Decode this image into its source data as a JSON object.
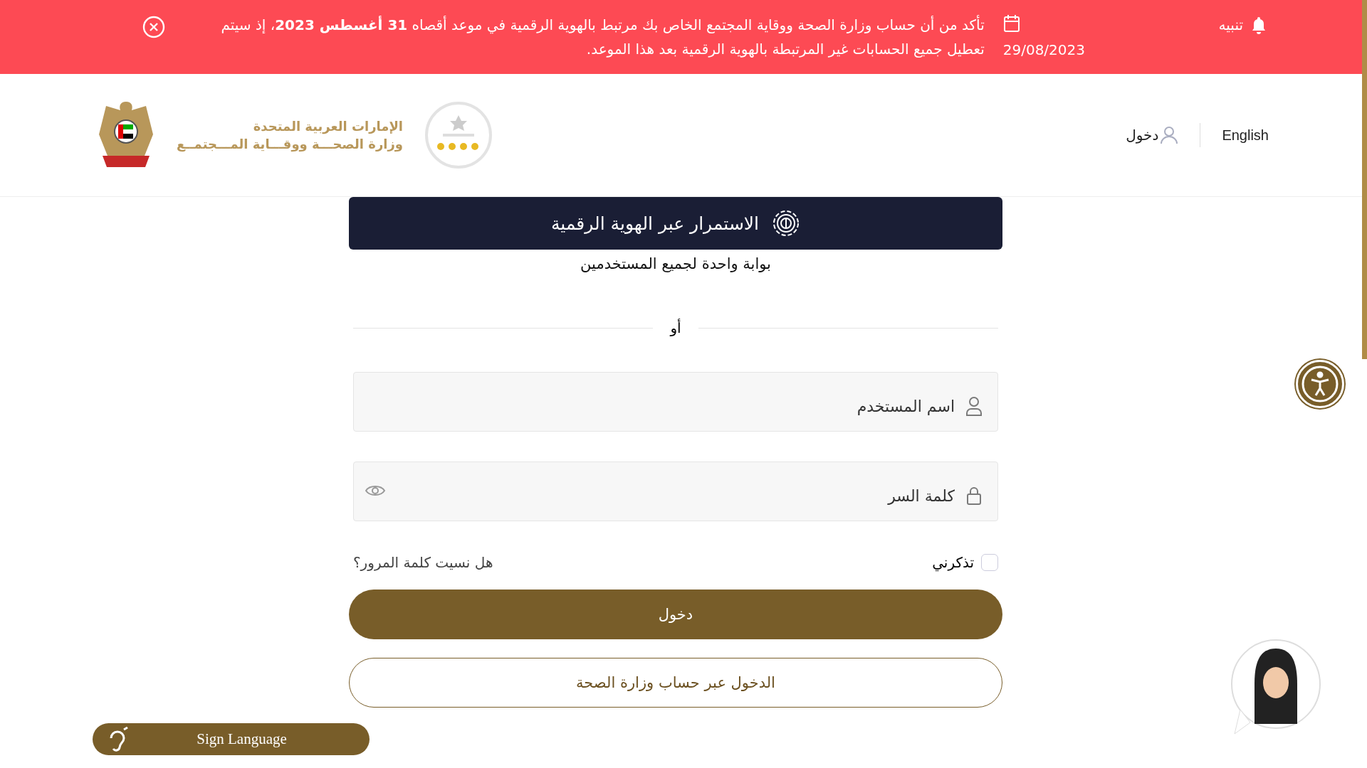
{
  "alert": {
    "label": "تنبيه",
    "date": "29/08/2023",
    "message": "تأكد من أن حساب وزارة الصحة ووقاية المجتمع الخاص بك مرتبط بالهوية الرقمية في موعد أقصاه **31 أغسطس 2023**، إذ سيتم تعطيل جميع الحسابات غير المرتبطة بالهوية الرقمية بعد هذا الموعد."
  },
  "header": {
    "language": "English",
    "login": "دخول",
    "logo_lines": [
      "الإمارات العربية المتحدة",
      "وزارة الصحـــة ووقـــاية المـــجتمــع"
    ]
  },
  "digital_id": {
    "button": "الاستمرار عبر الهوية الرقمية",
    "subtitle": "بوابة واحدة لجميع المستخدمين"
  },
  "divider": "أو",
  "fields": [
    {
      "kind": "text",
      "placeholder": "اسم المستخدم"
    },
    {
      "kind": "password",
      "placeholder": "كلمة السر"
    }
  ],
  "remember": {
    "label": "تذكرني",
    "checked": false
  },
  "forgot_link": "هل نسيت كلمة المرور؟",
  "buttons": [
    {
      "kind": "primary",
      "label": "دخول"
    },
    {
      "kind": "outline",
      "label": "الدخول عبر حساب وزارة الصحة"
    }
  ],
  "sign_language": "Sign Language"
}
